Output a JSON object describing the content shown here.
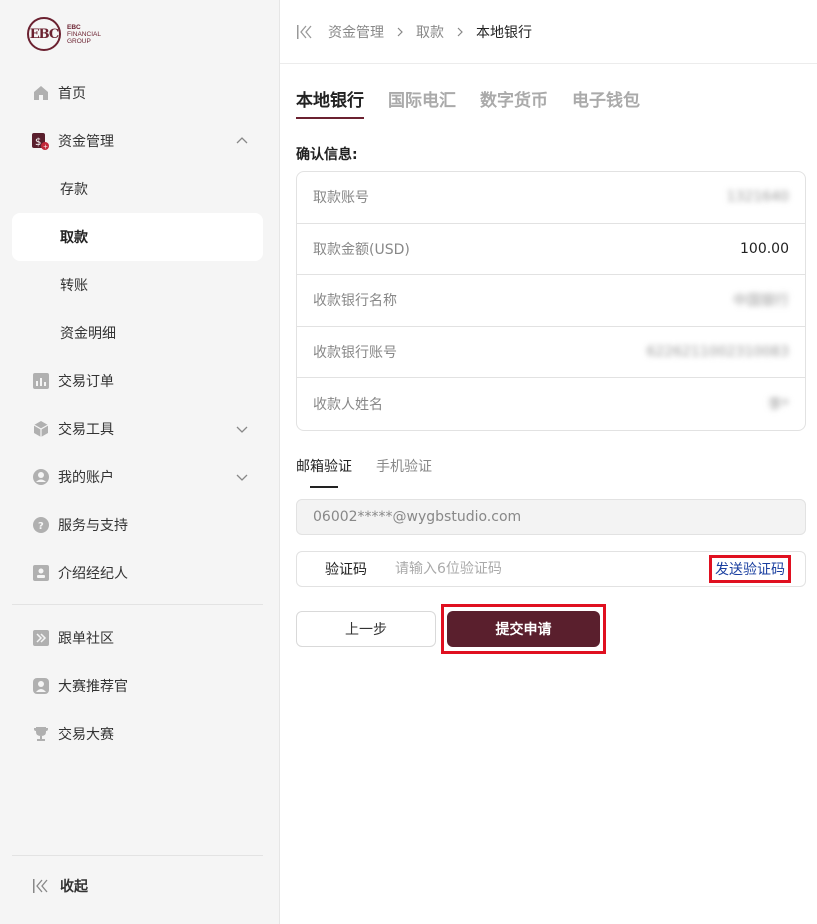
{
  "brand": {
    "line1": "EBC",
    "line2": "FINANCIAL",
    "line3": "GROUP",
    "mark": "EBC"
  },
  "sidebar": {
    "items": [
      {
        "label": "首页",
        "icon": "home-icon"
      },
      {
        "label": "资金管理",
        "icon": "fund-icon",
        "expanded": true,
        "children": [
          {
            "label": "存款"
          },
          {
            "label": "取款",
            "active": true
          },
          {
            "label": "转账"
          },
          {
            "label": "资金明细"
          }
        ]
      },
      {
        "label": "交易订单",
        "icon": "chart-icon"
      },
      {
        "label": "交易工具",
        "icon": "cube-icon"
      },
      {
        "label": "我的账户",
        "icon": "user-icon"
      },
      {
        "label": "服务与支持",
        "icon": "help-icon"
      },
      {
        "label": "介绍经纪人",
        "icon": "id-card-icon"
      }
    ],
    "extra_items": [
      {
        "label": "跟单社区",
        "icon": "forward-icon"
      },
      {
        "label": "大赛推荐官",
        "icon": "badge-icon"
      },
      {
        "label": "交易大赛",
        "icon": "trophy-icon"
      }
    ],
    "collapse_label": "收起"
  },
  "breadcrumb": {
    "items": [
      "资金管理",
      "取款",
      "本地银行"
    ]
  },
  "tabs": [
    "本地银行",
    "国际电汇",
    "数字货币",
    "电子钱包"
  ],
  "confirm": {
    "title": "确认信息:",
    "rows": [
      {
        "label": "取款账号",
        "value": "1321640",
        "blurred": true
      },
      {
        "label": "取款金额(USD)",
        "value": "100.00",
        "blurred": false
      },
      {
        "label": "收款银行名称",
        "value": "中国银行",
        "blurred": true
      },
      {
        "label": "收款银行账号",
        "value": "6226211002310083",
        "blurred": true
      },
      {
        "label": "收款人姓名",
        "value": "李*",
        "blurred": true
      }
    ]
  },
  "verify": {
    "tabs": [
      "邮箱验证",
      "手机验证"
    ],
    "email": "06002*****@wygbstudio.com",
    "code_label": "验证码",
    "code_placeholder": "请输入6位验证码",
    "send_label": "发送验证码"
  },
  "actions": {
    "prev_label": "上一步",
    "submit_label": "提交申请"
  },
  "colors": {
    "brand": "#6b2130",
    "submit_bg": "#5a1f2d",
    "highlight": "#e01020",
    "link": "#1a3fa0"
  }
}
